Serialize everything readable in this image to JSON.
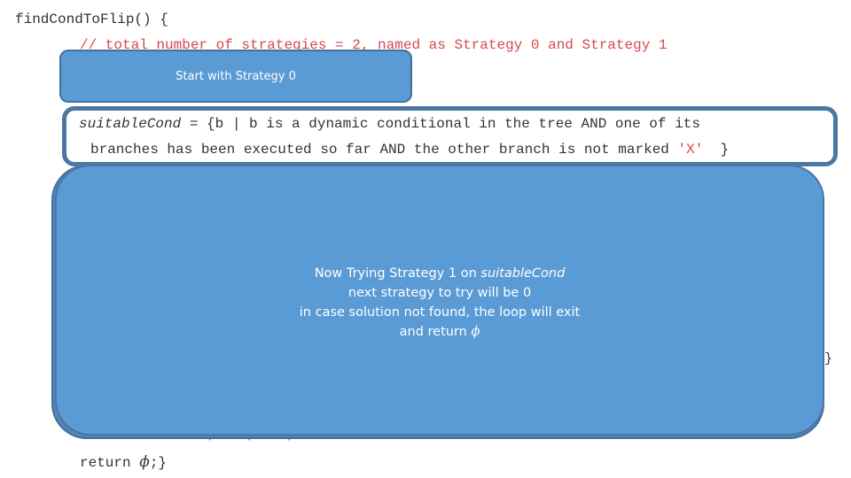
{
  "code": {
    "function_header": "findCondToFlip() {",
    "comment": "// total number of strategies = 2, named as Strategy 0 and Strategy 1",
    "condition": {
      "var_name": "suitableCond",
      "line1_rest": " = {b | b is a dynamic conditional in the tree AND one of its",
      "line2_before": "branches has been executed so far AND the other branch is not marked ",
      "marked_value": "'X'",
      "line2_after": "  }"
    },
    "return_keyword": "return ",
    "return_symbol": "ϕ",
    "return_end": ";}",
    "stray_brace": "}",
    "stray_dots": ", , ,"
  },
  "callouts": {
    "small": {
      "text": "Start with Strategy 0"
    },
    "big": {
      "line1_prefix": "Now Trying  Strategy 1 on ",
      "line1_italic": "suitableCond",
      "line2": "next strategy to try will be 0",
      "line3": "in case solution not found, the loop will exit",
      "line4_prefix": "and return ",
      "line4_symbol": "ϕ"
    }
  },
  "colors": {
    "callout_fill": "#5b9bd5",
    "callout_border": "#41719c",
    "comment_red": "#d8474c",
    "code_text": "#333333"
  }
}
